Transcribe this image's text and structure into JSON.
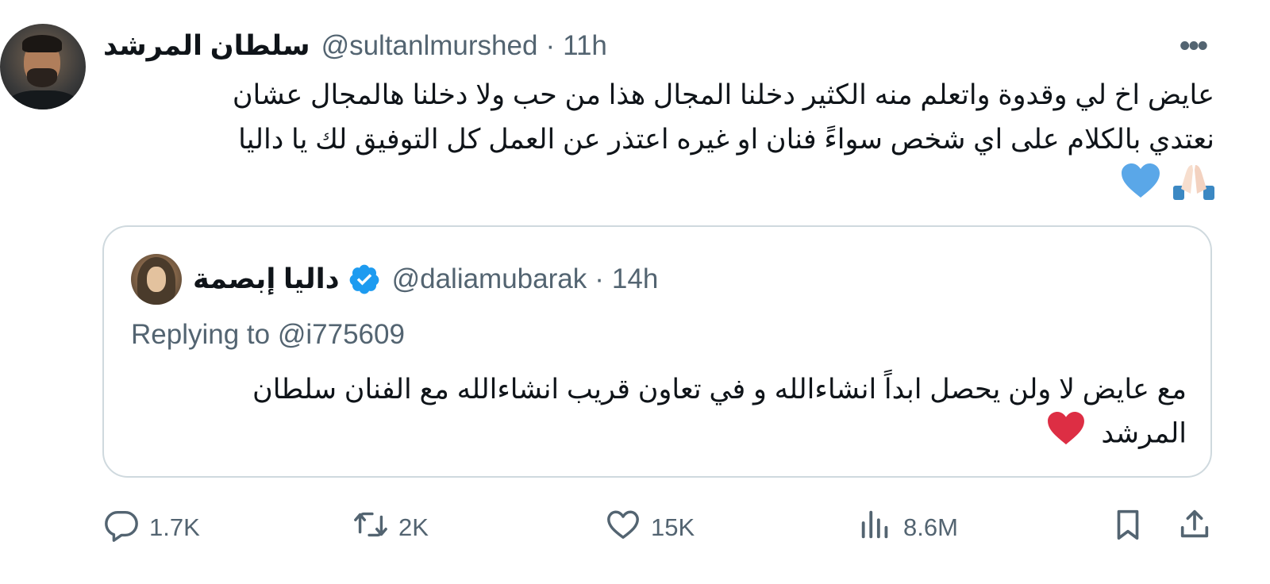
{
  "author": {
    "display_name": "سلطان المرشد",
    "handle": "@sultanlmurshed",
    "separator": "·",
    "time": "11h"
  },
  "more_label": "•••",
  "tweet": {
    "line1": "عايض اخ لي وقدوة واتعلم منه الكثير دخلنا المجال هذا من حب ولا دخلنا هالمجال عشان",
    "line2": "نعتدي بالكلام على اي شخص سواءً فنان او غيره اعتذر عن العمل كل التوفيق لك يا داليا",
    "emojis": [
      "folded-hands",
      "blue-heart"
    ]
  },
  "quote": {
    "display_name": "داليا إبصمة",
    "handle": "@daliamubarak",
    "separator": "·",
    "time": "14h",
    "replying_prefix": "Replying to",
    "replying_mention": "@i775609",
    "line1": "مع عايض لا ولن يحصل ابداً انشاءالله و في تعاون قريب انشاءالله مع الفنان سلطان",
    "line2": "المرشد",
    "emoji": "red-heart"
  },
  "actions": {
    "replies": "1.7K",
    "retweets": "2K",
    "likes": "15K",
    "views": "8.6M"
  },
  "colors": {
    "text": "#0f1419",
    "secondary": "#536471",
    "verified": "#1d9bf0",
    "border": "#cfd9de",
    "blue_heart": "#5aa7e8",
    "red_heart": "#dd2e44"
  }
}
